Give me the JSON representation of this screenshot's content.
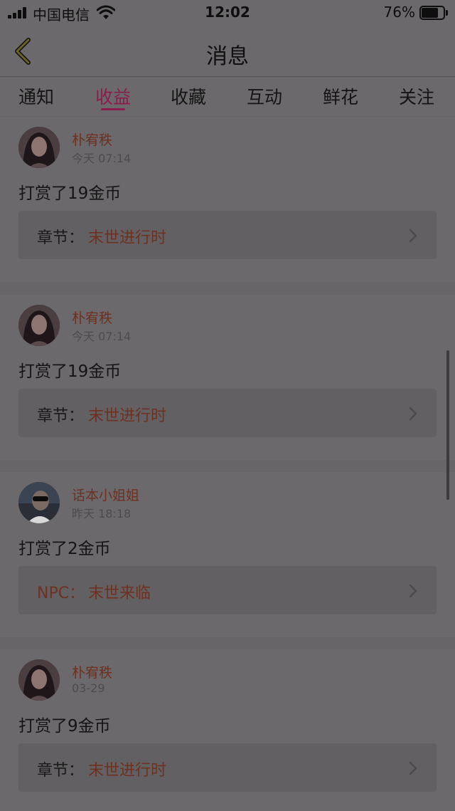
{
  "status_bar": {
    "carrier": "中国电信",
    "time": "12:02",
    "battery": "76%",
    "battery_level": 0.76,
    "icons": [
      "signal-icon",
      "wifi-icon",
      "battery-icon"
    ]
  },
  "nav": {
    "title": "消息",
    "back_icon": "chevron-left-icon"
  },
  "tabs": [
    {
      "label": "通知",
      "active": false
    },
    {
      "label": "收益",
      "active": true
    },
    {
      "label": "收藏",
      "active": false
    },
    {
      "label": "互动",
      "active": false
    },
    {
      "label": "鲜花",
      "active": false
    },
    {
      "label": "关注",
      "active": false
    }
  ],
  "messages": [
    {
      "name": "朴宥秩",
      "time": "今天 07:14",
      "text": "打赏了19金币",
      "link_label": "章节：",
      "link_value": "末世进行时",
      "avatar": "avatar-woman"
    },
    {
      "name": "朴宥秩",
      "time": "今天 07:14",
      "text": "打赏了19金币",
      "link_label": "章节：",
      "link_value": "末世进行时",
      "avatar": "avatar-woman"
    },
    {
      "name": "话本小姐姐",
      "time": "昨天 18:18",
      "text": "打赏了2金币",
      "link_label": "NPC：",
      "link_value": "末世来临",
      "avatar": "avatar-man-sunglasses"
    },
    {
      "name": "朴宥秩",
      "time": "03-29",
      "text": "打赏了9金币",
      "link_label": "章节：",
      "link_value": "末世进行时",
      "avatar": "avatar-woman"
    }
  ],
  "colors": {
    "accent": "#8a1d4d",
    "name_link": "#6e3020",
    "overlay_dim": "#6b696b"
  }
}
